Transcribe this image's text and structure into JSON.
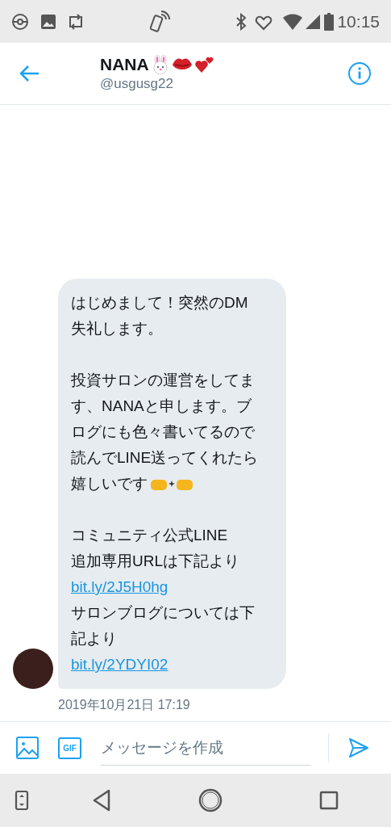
{
  "status_bar": {
    "time": "10:15"
  },
  "header": {
    "name": "NANA",
    "handle": "@usgusg22"
  },
  "message": {
    "paragraphs": [
      [
        {
          "kind": "text",
          "text": "はじめまして！突然のDM\n失礼します。"
        }
      ],
      [
        {
          "kind": "text",
          "text": "投資サロンの運営をしてます、NANAと申します。ブログにも色々書いてるので読んでLINE送ってくれたら"
        },
        {
          "kind": "text_emoji",
          "text": "嬉しいです"
        }
      ],
      [
        {
          "kind": "text",
          "text": "コミュニティ公式LINE\n追加専用URLは下記より"
        },
        {
          "kind": "link",
          "text": "bit.ly/2J5H0hg"
        },
        {
          "kind": "text",
          "text": "サロンブログについては下記より"
        },
        {
          "kind": "link",
          "text": "bit.ly/2YDYI02"
        }
      ]
    ],
    "timestamp": "2019年10月21日 17:19"
  },
  "composer": {
    "gif_label": "GIF",
    "placeholder": "メッセージを作成"
  }
}
